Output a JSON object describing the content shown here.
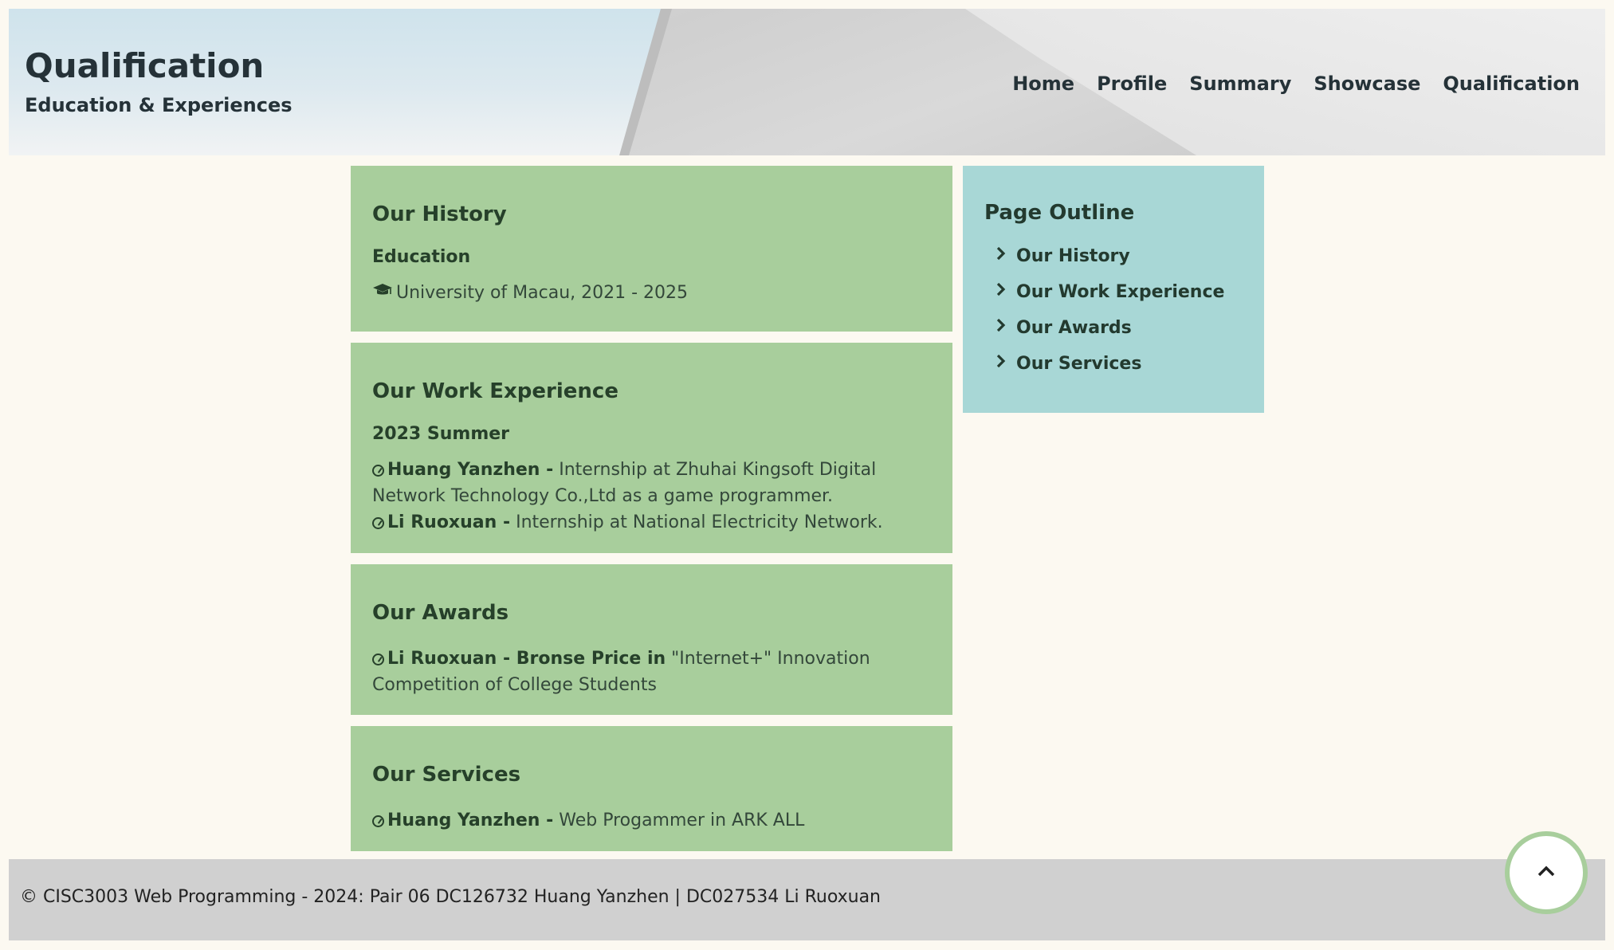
{
  "header": {
    "title": "Qualification",
    "subtitle": "Education & Experiences",
    "nav": [
      "Home",
      "Profile",
      "Summary",
      "Showcase",
      "Qualification"
    ]
  },
  "history": {
    "heading": "Our History",
    "subheading": "Education",
    "icon": "graduation-cap-icon",
    "entry": "University of Macau, 2021 - 2025"
  },
  "work": {
    "heading": "Our Work Experience",
    "subheading": "2023 Summer",
    "entries": [
      {
        "name": "Huang Yanzhen -",
        "text": " Internship at Zhuhai Kingsoft Digital Network Technology Co.,Ltd as a game programmer."
      },
      {
        "name": "Li Ruoxuan -",
        "text": " Internship at National Electricity Network."
      }
    ]
  },
  "awards": {
    "heading": "Our Awards",
    "entries": [
      {
        "name": "Li Ruoxuan - Bronse Price in",
        "text": " \"Internet+\" Innovation Competition of College Students"
      }
    ]
  },
  "services": {
    "heading": "Our Services",
    "entries": [
      {
        "name": "Huang Yanzhen -",
        "text": " Web Progammer in ARK ALL"
      }
    ]
  },
  "outline": {
    "heading": "Page Outline",
    "items": [
      "Our History",
      "Our Work Experience",
      "Our Awards",
      "Our Services"
    ]
  },
  "footer": {
    "text": "© CISC3003 Web Programming - 2024: Pair 06 DC126732 Huang Yanzhen | DC027534 Li Ruoxuan"
  },
  "colors": {
    "background": "#fcf9f1",
    "card_green": "#a8ce9c",
    "outline_teal": "#a8d7d6",
    "footer_gray": "#d0d0d0"
  }
}
